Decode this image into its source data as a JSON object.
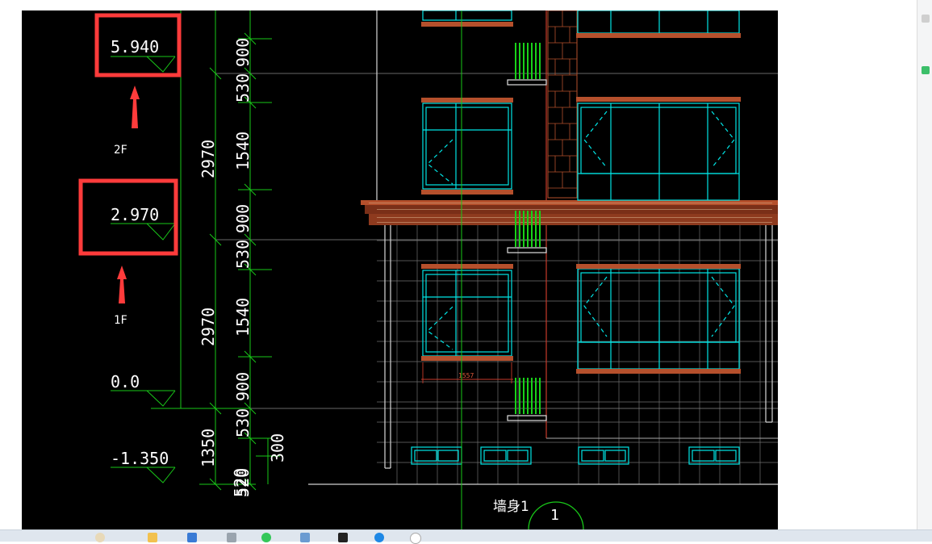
{
  "drawing": {
    "levels": [
      {
        "elevation": "5.940",
        "floor": "2F",
        "highlighted": true
      },
      {
        "elevation": "2.970",
        "floor": "1F",
        "highlighted": true
      },
      {
        "elevation": "0.0",
        "floor": "",
        "highlighted": false
      },
      {
        "elevation": "-1.350",
        "floor": "",
        "highlighted": false
      }
    ],
    "dim_total": [
      "2970",
      "2970",
      "1350",
      "520"
    ],
    "dim_detail": [
      "900",
      "530",
      "1540",
      "900",
      "530",
      "1540",
      "900",
      "530",
      "520"
    ],
    "dim_extra": "300",
    "small_dim": "1557",
    "axis_label": "墙身1",
    "axis_bubble": "1"
  },
  "colors": {
    "background": "#000000",
    "dimension": "#00c800",
    "text": "#ffffff",
    "window": "#00e5e5",
    "highlight_box": "#ff3b3b",
    "brick": "#b5502c",
    "railing": "#19d119",
    "grid": "#7d7d7d"
  },
  "taskbar": {
    "icons": [
      "user-avatar-icon",
      "folder-icon",
      "screen-icon",
      "app-icon",
      "green-app-icon",
      "file-icon",
      "media-icon",
      "browser-icon",
      "circle-icon"
    ]
  }
}
